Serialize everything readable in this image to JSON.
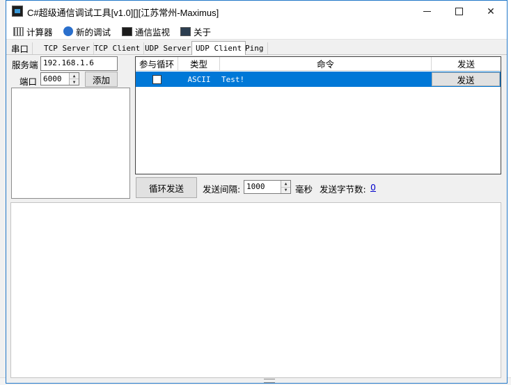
{
  "window": {
    "title": "C#超级通信调试工具[v1.0][][江苏常州-Maximus]"
  },
  "menu": [
    {
      "label": "计算器",
      "icon": "calculator-icon"
    },
    {
      "label": "新的调试",
      "icon": "ie-icon"
    },
    {
      "label": "通信监视",
      "icon": "monitor-icon"
    },
    {
      "label": "关于",
      "icon": "info-icon"
    }
  ],
  "tabs": [
    "串口",
    "TCP Server",
    "TCP Client",
    "UDP Server",
    "UDP Client",
    "Ping"
  ],
  "active_tab": "UDP Client",
  "left_panel": {
    "server_label": "服务端",
    "server_value": "192.168.1.6",
    "port_label": "端口",
    "port_value": "6000",
    "add_button": "添加"
  },
  "grid": {
    "headers": [
      "参与循环",
      "类型",
      "命令",
      "发送"
    ],
    "rows": [
      {
        "checked": false,
        "type": "ASCII",
        "command": "Test!",
        "send_button": "发送"
      }
    ]
  },
  "send_controls": {
    "loop_button": "循环发送",
    "interval_label": "发送间隔:",
    "interval_value": "1000",
    "unit": "毫秒",
    "bytes_label": "发送字节数:",
    "bytes_value": "0"
  },
  "colors": {
    "selection": "#0078d7",
    "window_border": "#1f76c8",
    "link": "#0000cc"
  }
}
